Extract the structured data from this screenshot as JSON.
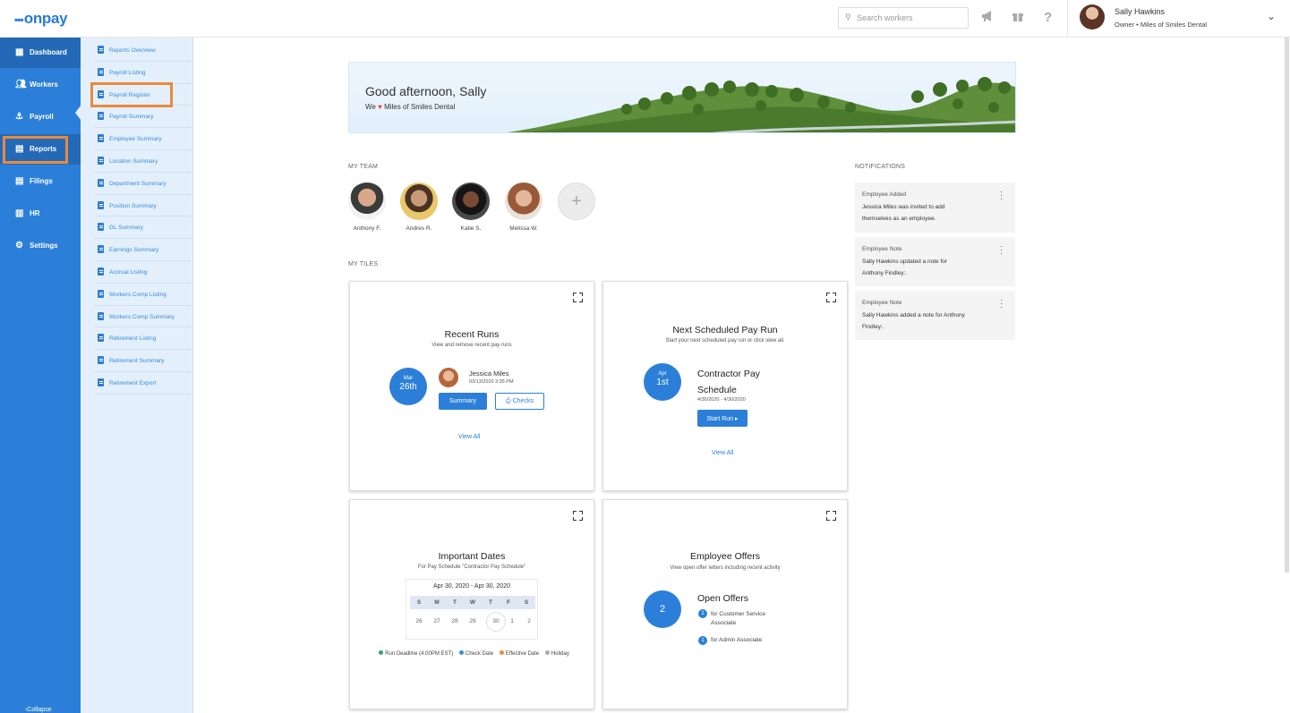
{
  "app": {
    "logo": "onpay"
  },
  "topbar": {
    "search_placeholder": "Search workers",
    "user_name": "Sally Hawkins",
    "user_role": "Owner • Miles of Smiles Dental"
  },
  "sidebar": {
    "items": [
      {
        "label": "Dashboard",
        "icon": "dashboard-icon"
      },
      {
        "label": "Workers",
        "icon": "workers-icon"
      },
      {
        "label": "Payroll",
        "icon": "payroll-icon"
      },
      {
        "label": "Reports",
        "icon": "reports-icon"
      },
      {
        "label": "Filings",
        "icon": "filings-icon"
      },
      {
        "label": "HR",
        "icon": "hr-icon"
      },
      {
        "label": "Settings",
        "icon": "gear-icon"
      }
    ],
    "collapse_label": "Collapse"
  },
  "submenu": {
    "items": [
      "Reports Overview",
      "Payroll Listing",
      "Payroll Register",
      "Payroll Summary",
      "Employee Summary",
      "Location Summary",
      "Department Summary",
      "Position Summary",
      "GL Summary",
      "Earnings Summary",
      "Accrual Listing",
      "Workers Comp Listing",
      "Workers Comp Summary",
      "Retirement Listing",
      "Retirement Summary",
      "Retirement Export"
    ]
  },
  "banner": {
    "greeting": "Good afternoon, Sally",
    "we": "We",
    "company": "Miles of Smiles Dental"
  },
  "team": {
    "label": "MY TEAM",
    "members": [
      "Anthony F.",
      "Andres R.",
      "Katie S.",
      "Melissa W."
    ]
  },
  "tiles_label": "MY TILES",
  "tiles": {
    "recent_runs": {
      "title": "Recent Runs",
      "desc": "View and remove recent pay runs",
      "month": "Mar",
      "day": "26th",
      "person": "Jessica Miles",
      "datetime": "03/13/2020 3:35 PM",
      "summary_btn": "Summary",
      "checks_btn": "Checks",
      "view_all": "View All"
    },
    "next_pay_run": {
      "title": "Next Scheduled Pay Run",
      "desc": "Start your next scheduled pay run or click view all.",
      "month": "Apr",
      "day": "1st",
      "schedule_line1": "Contractor Pay",
      "schedule_line2": "Schedule",
      "period": "4/30/2020 - 4/30/2020",
      "start_btn": "Start Run ▸",
      "view_all": "View All"
    },
    "important_dates": {
      "title": "Important Dates",
      "desc": "For Pay Schedule \"Contractor Pay Schedule\"",
      "range": "Apr 30, 2020 - Apr 30, 2020",
      "dow": [
        "S",
        "M",
        "T",
        "W",
        "T",
        "F",
        "S"
      ],
      "days": [
        "26",
        "27",
        "28",
        "29",
        "30",
        "1",
        "2"
      ],
      "legend": [
        {
          "label": "Run Deadline (4:00PM EST)",
          "color": "#2aa37a"
        },
        {
          "label": "Check Date",
          "color": "#3a8ad9"
        },
        {
          "label": "Effective Date",
          "color": "#e88a3c"
        },
        {
          "label": "Holiday",
          "color": "#aaaaaa"
        }
      ]
    },
    "employee_offers": {
      "title": "Employee Offers",
      "desc": "View open offer letters including recent activity",
      "count": "2",
      "heading": "Open Offers",
      "offers": [
        {
          "num": "1",
          "line1": "for Customer Service",
          "line2": "Associate"
        },
        {
          "num": "1",
          "line1": "for Admin Associate",
          "line2": ""
        }
      ]
    }
  },
  "notifications": {
    "label": "NOTIFICATIONS",
    "items": [
      {
        "type": "Employee Added",
        "line1": "Jessica Miles was invited to add",
        "line2": "themselves as an employee."
      },
      {
        "type": "Employee Note",
        "line1": "Sally Hawkins updated a note for",
        "line2": "Anthony Findley:."
      },
      {
        "type": "Employee Note",
        "line1": "Sally Hawkins added a note for Anthony",
        "line2": "Findley:."
      }
    ]
  },
  "colors": {
    "brand": "#2b7fd8",
    "highlight": "#e88a3c",
    "heart": "#e0403a"
  }
}
